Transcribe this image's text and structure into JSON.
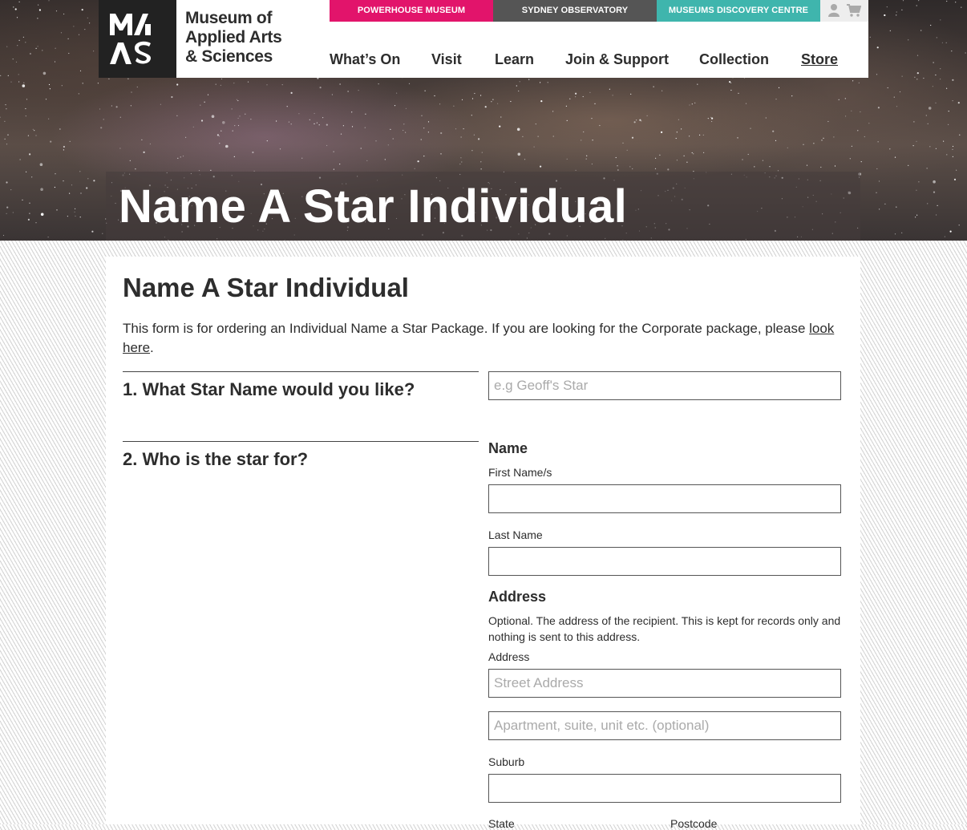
{
  "header": {
    "logo_text": "MAAS",
    "brand_lines": [
      "Museum of",
      "Applied Arts",
      "& Sciences"
    ],
    "top_links": [
      {
        "label": "POWERHOUSE MUSEUM",
        "color": "#e2146b"
      },
      {
        "label": "SYDNEY OBSERVATORY",
        "color": "#555555"
      },
      {
        "label": "MUSEUMS DISCOVERY CENTRE",
        "color": "#3fb5ad"
      }
    ],
    "icons": [
      "user-icon",
      "cart-icon"
    ],
    "nav": [
      "What’s On",
      "Visit",
      "Learn",
      "Join & Support",
      "Collection",
      "Store"
    ]
  },
  "hero": {
    "title": "Name A Star Individual"
  },
  "content": {
    "heading": "Name A Star Individual",
    "intro_text": "This form is for ordering an Individual Name a Star Package. If you are looking for the Corporate package, please ",
    "intro_link": "look here",
    "intro_end": ".",
    "q1": {
      "title": "1. What Star Name would you like?",
      "placeholder": "e.g Geoff's Star"
    },
    "q2": {
      "title": "2. Who is the star for?",
      "name_heading": "Name",
      "first_name_label": "First Name/s",
      "last_name_label": "Last Name",
      "address_heading": "Address",
      "address_note": "Optional. The address of the recipient. This is kept for records only and nothing is sent to this address.",
      "address_label": "Address",
      "street_placeholder": "Street Address",
      "apartment_placeholder": "Apartment, suite, unit etc. (optional)",
      "suburb_label": "Suburb",
      "state_label": "State",
      "postcode_label": "Postcode"
    }
  }
}
